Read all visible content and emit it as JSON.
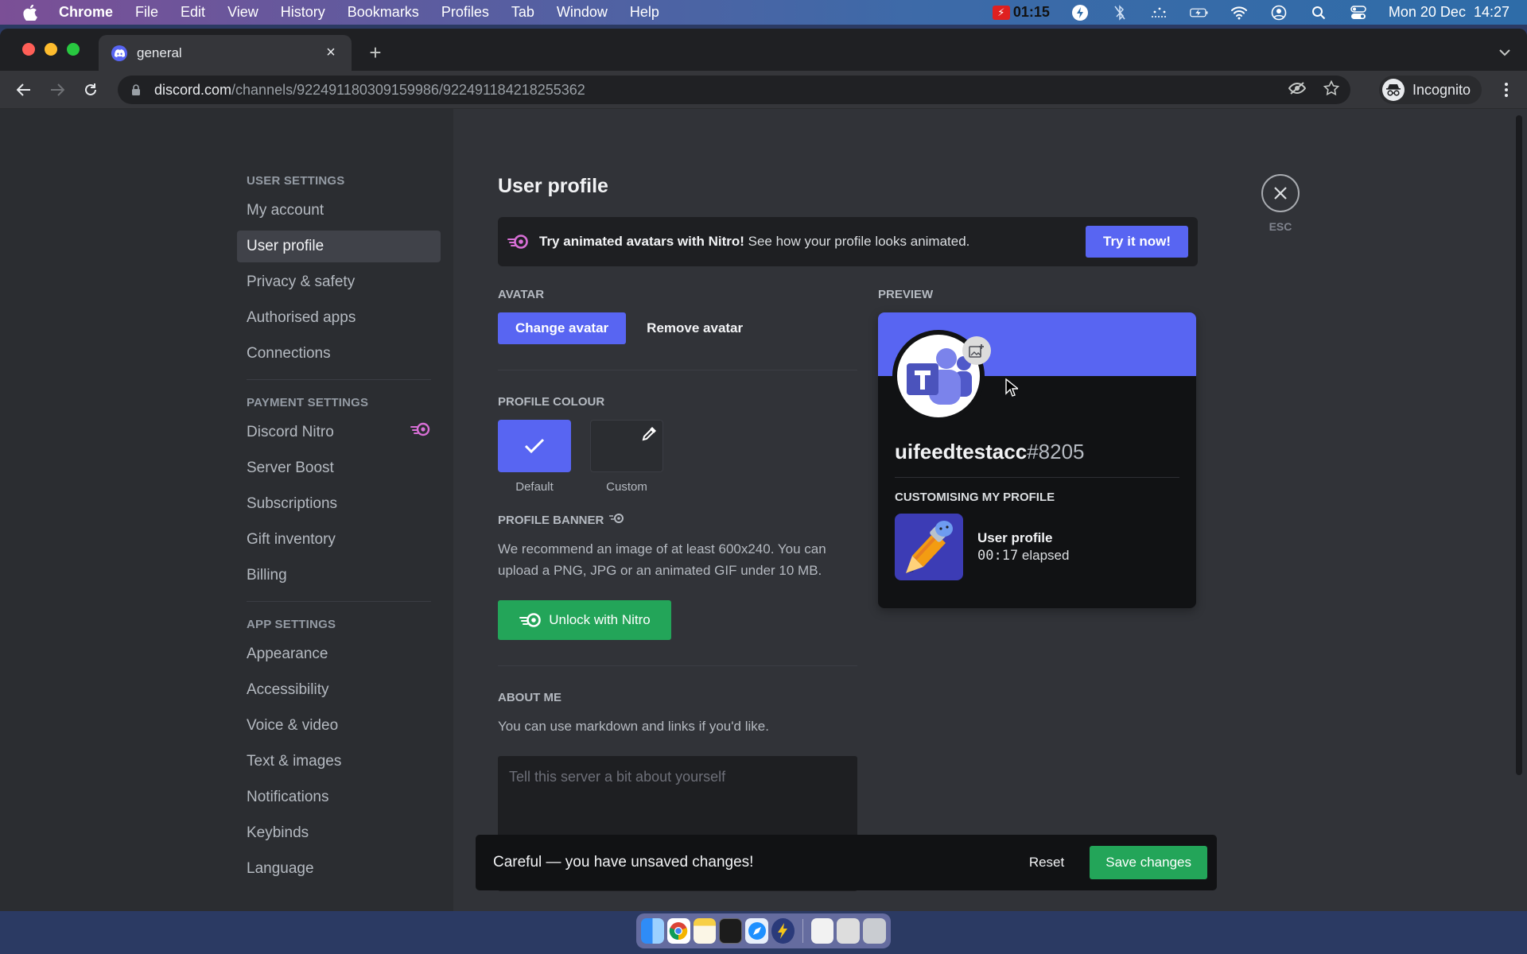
{
  "menubar": {
    "app": "Chrome",
    "items": [
      "File",
      "Edit",
      "View",
      "History",
      "Bookmarks",
      "Profiles",
      "Tab",
      "Window",
      "Help"
    ],
    "recording_time": "01:15",
    "datetime": "Mon 20 Dec  14:27"
  },
  "browser": {
    "tab_title": "general",
    "url_host": "discord.com",
    "url_path": "/channels/922491180309159986/922491184218255362",
    "profile_label": "Incognito"
  },
  "sidebar": {
    "sections": [
      {
        "header": "USER SETTINGS",
        "items": [
          "My account",
          "User profile",
          "Privacy & safety",
          "Authorised apps",
          "Connections"
        ]
      },
      {
        "header": "PAYMENT SETTINGS",
        "items": [
          "Discord Nitro",
          "Server Boost",
          "Subscriptions",
          "Gift inventory",
          "Billing"
        ]
      },
      {
        "header": "APP SETTINGS",
        "items": [
          "Appearance",
          "Accessibility",
          "Voice & video",
          "Text & images",
          "Notifications",
          "Keybinds",
          "Language"
        ]
      }
    ],
    "active": "User profile"
  },
  "page": {
    "title": "User profile",
    "nitro_banner": {
      "bold": "Try animated avatars with Nitro!",
      "text": " See how your profile looks animated.",
      "button": "Try it now!"
    },
    "avatar": {
      "label": "AVATAR",
      "change": "Change avatar",
      "remove": "Remove avatar"
    },
    "profile_colour": {
      "label": "PROFILE COLOUR",
      "default_label": "Default",
      "custom_label": "Custom",
      "selected": "Default",
      "default_color": "#5865f2"
    },
    "profile_banner": {
      "label": "PROFILE BANNER",
      "description": "We recommend an image of at least 600x240. You can upload a PNG, JPG or an animated GIF under 10 MB.",
      "button": "Unlock with Nitro"
    },
    "about_me": {
      "label": "ABOUT ME",
      "description": "You can use markdown and links if you'd like.",
      "placeholder": "Tell this server a bit about yourself"
    },
    "esc_label": "ESC"
  },
  "preview": {
    "label": "PREVIEW",
    "username": "uifeedtestacc",
    "discriminator": "#8205",
    "activity_header": "CUSTOMISING MY PROFILE",
    "activity_title": "User profile",
    "activity_time": "00:17",
    "activity_suffix": " elapsed",
    "banner_color": "#5865f2"
  },
  "unsaved": {
    "message": "Careful — you have unsaved changes!",
    "reset": "Reset",
    "save": "Save changes"
  },
  "dock": {
    "apps": [
      "finder",
      "chrome",
      "notes",
      "terminal",
      "safari",
      "nitro-app",
      "preview-doc",
      "screenshot",
      "trash"
    ]
  }
}
